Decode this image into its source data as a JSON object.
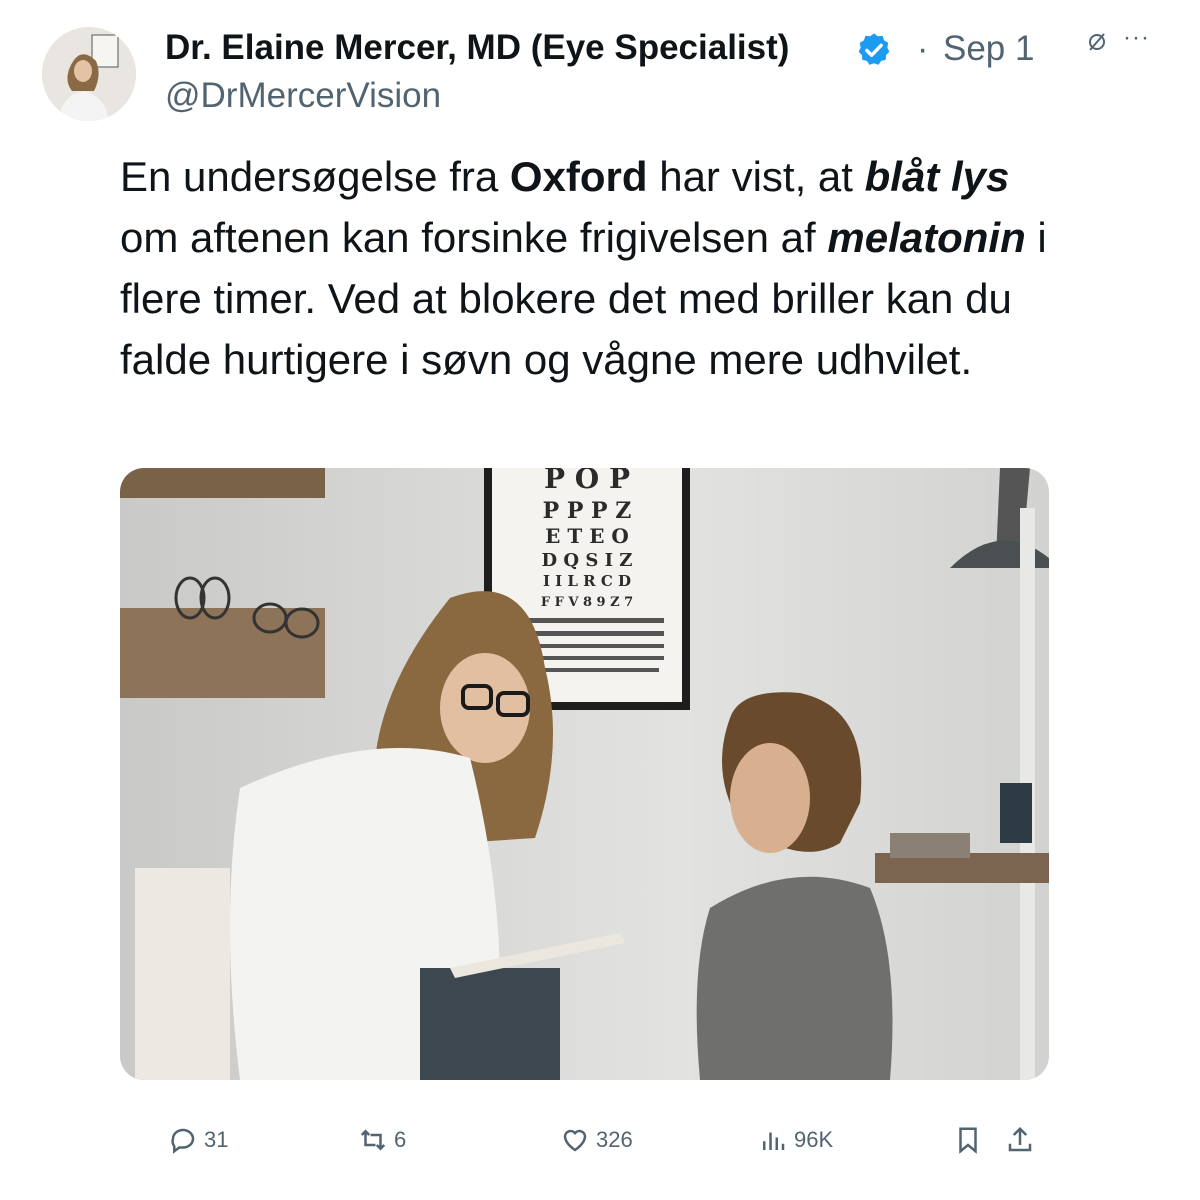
{
  "author": {
    "name": "Dr. Elaine Mercer, MD (Eye Specialist)",
    "handle": "@DrMercerVision",
    "verified": true,
    "verified_color": "#1d9bf0"
  },
  "meta": {
    "separator": "·",
    "date": "Sep 1",
    "grok_icon": "slashed-circle-icon",
    "more_label": "···"
  },
  "tweet": {
    "t1": "En undersøgelse fra ",
    "t2": "Oxford",
    "t3": " har vist, at ",
    "t4": "blåt lys",
    "t5": " om aftenen kan forsinke frigivelsen af ",
    "t6": "melatonin",
    "t7": " i flere timer. Ved at blokere det med briller kan du falde hurtigere i søvn og vågne mere udhvilet."
  },
  "media": {
    "eye_chart_rows": [
      "P O P",
      "P P P Z",
      "E T E O",
      "D Q S I Z",
      "I I L R C D",
      "F F V 8 9 Z 7"
    ]
  },
  "actions": {
    "replies": "31",
    "reposts": "6",
    "likes": "326",
    "views": "96K"
  },
  "colors": {
    "text": "#0f1419",
    "secondary": "#536471"
  }
}
